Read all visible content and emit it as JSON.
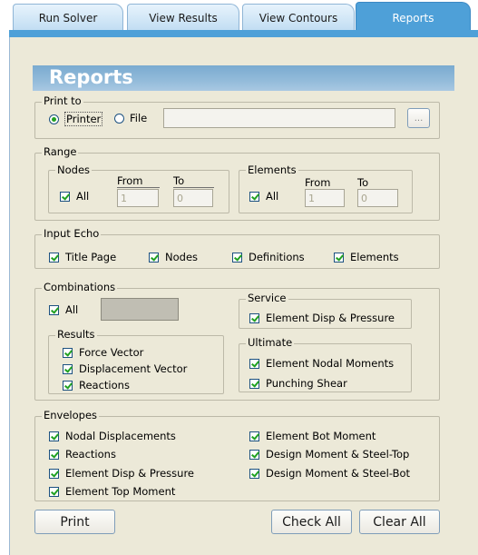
{
  "tabs": [
    {
      "label": "Run Solver"
    },
    {
      "label": "View Results"
    },
    {
      "label": "View Contours"
    },
    {
      "label": "Reports"
    }
  ],
  "title": "Reports",
  "print_to": {
    "legend": "Print to",
    "printer_label": "Printer",
    "file_label": "File",
    "file_path": "",
    "browse_label": "...",
    "selected": "Printer"
  },
  "range": {
    "legend": "Range",
    "nodes": {
      "legend": "Nodes",
      "all_label": "All",
      "from_label": "From",
      "to_label": "To",
      "from_value": "1",
      "to_value": "0"
    },
    "elements": {
      "legend": "Elements",
      "all_label": "All",
      "from_label": "From",
      "to_label": "To",
      "from_value": "1",
      "to_value": "0"
    }
  },
  "input_echo": {
    "legend": "Input Echo",
    "items": [
      "Title Page",
      "Nodes",
      "Definitions",
      "Elements"
    ]
  },
  "combinations": {
    "legend": "Combinations",
    "all_label": "All",
    "results": {
      "legend": "Results",
      "items": [
        "Force Vector",
        "Displacement Vector",
        "Reactions"
      ]
    },
    "service": {
      "legend": "Service",
      "items": [
        "Element Disp & Pressure"
      ]
    },
    "ultimate": {
      "legend": "Ultimate",
      "items": [
        "Element Nodal Moments",
        "Punching Shear"
      ]
    }
  },
  "envelopes": {
    "legend": "Envelopes",
    "left": [
      "Nodal Displacements",
      "Reactions",
      "Element Disp & Pressure",
      "Element Top Moment"
    ],
    "right": [
      "Element Bot Moment",
      "Design Moment & Steel-Top",
      "Design Moment & Steel-Bot"
    ]
  },
  "buttons": {
    "print": "Print",
    "check_all": "Check All",
    "clear_all": "Clear All"
  },
  "colors": {
    "tab_active": "#4ea0d8",
    "panel": "#ece9d8",
    "title_bar": "#7aaad0",
    "check": "#21a121"
  }
}
